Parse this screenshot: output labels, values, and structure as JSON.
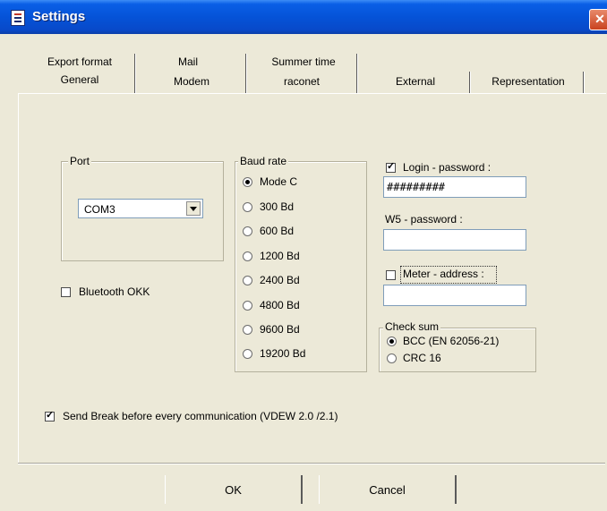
{
  "window": {
    "title": "Settings"
  },
  "tabs": {
    "export_format": "Export format",
    "mail": "Mail",
    "summer_time": "Summer time",
    "general": "General",
    "modem": "Modem",
    "raconet": "raconet",
    "external": "External",
    "representation": "Representation",
    "active": "General"
  },
  "port": {
    "label": "Port",
    "value": "COM3"
  },
  "bluetooth": {
    "label": "Bluetooth OKK",
    "checked": false
  },
  "baud_rate": {
    "label": "Baud rate",
    "options": [
      "Mode C",
      "300 Bd",
      "600 Bd",
      "1200 Bd",
      "2400 Bd",
      "4800 Bd",
      "9600 Bd",
      "19200 Bd"
    ],
    "selected": "Mode C"
  },
  "login_password": {
    "label": "Login - password :",
    "checked": true,
    "value": "#########"
  },
  "w5_password": {
    "label": "W5 - password :",
    "value": ""
  },
  "meter_address": {
    "label": "Meter - address :",
    "checked": false,
    "value": ""
  },
  "check_sum": {
    "label": "Check sum",
    "options": [
      "BCC (EN 62056-21)",
      "CRC 16"
    ],
    "selected": "BCC (EN 62056-21)"
  },
  "send_break": {
    "label": "Send Break before every communication (VDEW 2.0 /2.1)",
    "checked": true
  },
  "buttons": {
    "ok": "OK",
    "cancel": "Cancel"
  }
}
